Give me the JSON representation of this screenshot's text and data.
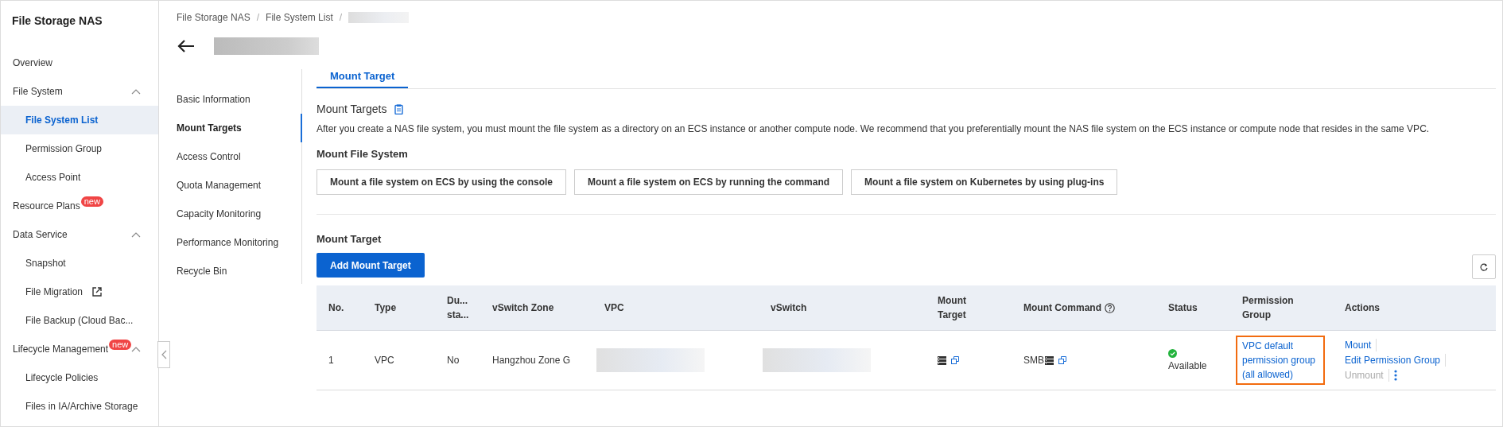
{
  "sidebar": {
    "title": "File Storage NAS",
    "items": [
      {
        "label": "Overview",
        "selected": false
      },
      {
        "label": "File System",
        "expanded": true,
        "children": [
          {
            "label": "File System List",
            "selected": true
          },
          {
            "label": "Permission Group",
            "selected": false
          },
          {
            "label": "Access Point",
            "selected": false
          }
        ]
      },
      {
        "label": "Resource Plans",
        "badge": "new",
        "selected": false
      },
      {
        "label": "Data Service",
        "expanded": true,
        "children": [
          {
            "label": "Snapshot",
            "selected": false
          },
          {
            "label": "File Migration",
            "external": true,
            "selected": false
          },
          {
            "label": "File Backup (Cloud Bac...",
            "selected": false
          }
        ]
      },
      {
        "label": "Lifecycle Management",
        "badge": "new",
        "expanded": true,
        "children": [
          {
            "label": "Lifecycle Policies",
            "selected": false
          },
          {
            "label": "Files in IA/Archive Storage",
            "selected": false
          }
        ]
      }
    ]
  },
  "breadcrumb": [
    {
      "label": "File Storage NAS",
      "separator": "/"
    },
    {
      "label": "File System List",
      "separator": "/"
    }
  ],
  "subnav": [
    {
      "label": "Basic Information",
      "selected": false
    },
    {
      "label": "Mount Targets",
      "selected": true
    },
    {
      "label": "Access Control",
      "selected": false
    },
    {
      "label": "Quota Management",
      "selected": false
    },
    {
      "label": "Capacity Monitoring",
      "selected": false
    },
    {
      "label": "Performance Monitoring",
      "selected": false
    },
    {
      "label": "Recycle Bin",
      "selected": false
    }
  ],
  "tabs": [
    {
      "label": "Mount Target",
      "selected": true
    }
  ],
  "section": {
    "title": "Mount Targets",
    "description": "After you create a NAS file system, you must mount the file system as a directory on an ECS instance or another compute node. We recommend that you preferentially mount the NAS file system on the ECS instance or compute node that resides in the same VPC.",
    "subtitle": "Mount File System",
    "buttons": [
      "Mount a file system on ECS by using the console",
      "Mount a file system on ECS by running the command",
      "Mount a file system on Kubernetes by using plug-ins"
    ]
  },
  "mount_target": {
    "title": "Mount Target",
    "add_button": "Add Mount Target",
    "table": {
      "columns": [
        {
          "label": "No."
        },
        {
          "label": "Type"
        },
        {
          "label": "Du... sta..."
        },
        {
          "label": "vSwitch Zone"
        },
        {
          "label": "VPC"
        },
        {
          "label": "vSwitch"
        },
        {
          "label": "Mount Target"
        },
        {
          "label": "Mount Command",
          "help": true
        },
        {
          "label": "Status"
        },
        {
          "label": "Permission Group"
        },
        {
          "label": "Actions"
        }
      ],
      "rows": [
        {
          "no": "1",
          "type": "VPC",
          "dual_stack": "No",
          "zone": "Hangzhou Zone G",
          "mount_command": "SMB",
          "status": "Available",
          "permission_group": "VPC default permission group (all allowed)",
          "highlighted": true,
          "actions": [
            {
              "label": "Mount",
              "disabled": false
            },
            {
              "label": "Edit Permission Group",
              "disabled": false
            },
            {
              "label": "Unmount",
              "disabled": true
            }
          ]
        }
      ]
    }
  }
}
